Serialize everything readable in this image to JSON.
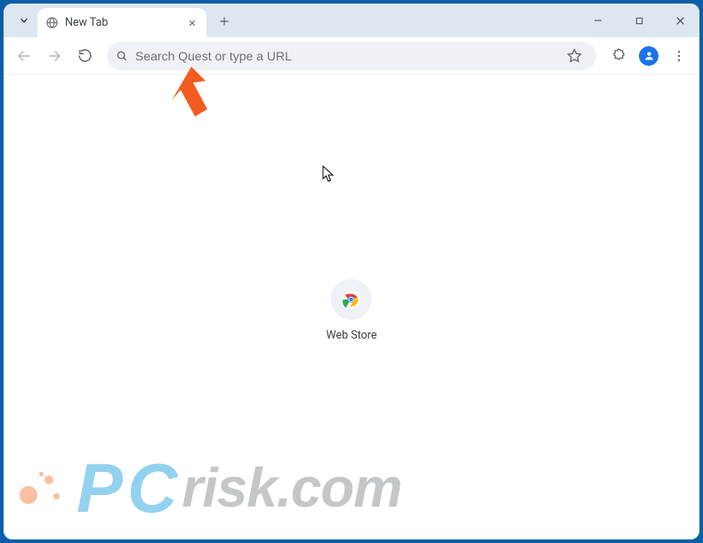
{
  "tab": {
    "title": "New Tab"
  },
  "omnibox": {
    "placeholder": "Search Quest or type a URL"
  },
  "shortcut": {
    "label": "Web Store"
  },
  "watermark": {
    "text": "risk.com"
  },
  "icons": {
    "tab_dropdown": "tab-search-icon",
    "favicon": "globe-icon",
    "close": "close-icon",
    "plus": "plus-icon",
    "minimize": "minimize-icon",
    "maximize": "maximize-icon",
    "window_close": "close-icon",
    "back": "arrow-left-icon",
    "forward": "arrow-right-icon",
    "reload": "reload-icon",
    "search": "search-icon",
    "star": "star-icon",
    "extensions": "puzzle-icon",
    "profile": "user-icon",
    "menu": "dots-vertical-icon",
    "annotation": "pointer-arrow-icon",
    "cursor": "cursor-icon",
    "chrome": "chrome-logo-icon"
  },
  "colors": {
    "window_border": "#0a5fa8",
    "tabstrip": "#dde7f2",
    "accent": "#1a73e8",
    "annotation_arrow": "#f25c1f"
  }
}
